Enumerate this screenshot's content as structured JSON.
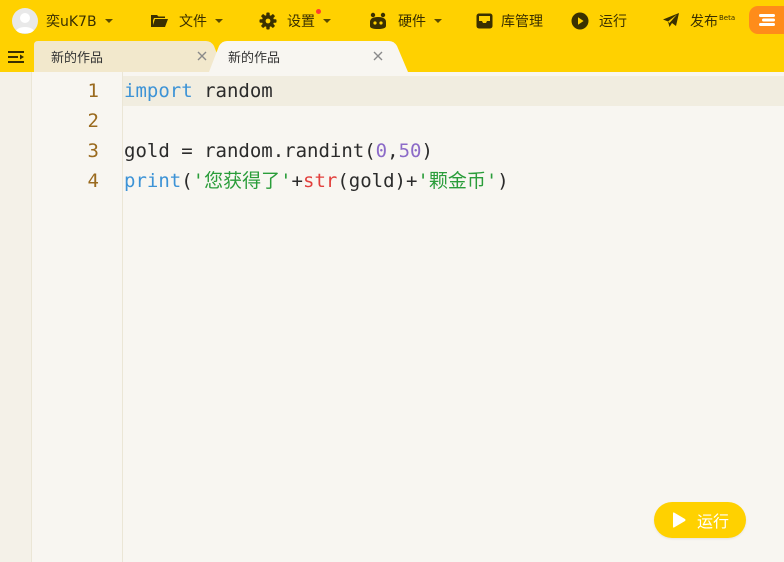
{
  "toolbar": {
    "user": {
      "name": "奕uK7B"
    },
    "file": {
      "label": "文件"
    },
    "settings": {
      "label": "设置"
    },
    "hardware": {
      "label": "硬件"
    },
    "library": {
      "label": "库管理"
    },
    "run": {
      "label": "运行"
    },
    "publish": {
      "label": "发布",
      "badge": "Beta"
    }
  },
  "tabs": [
    {
      "title": "新的作品",
      "active": false
    },
    {
      "title": "新的作品",
      "active": true
    }
  ],
  "editor": {
    "lines": [
      {
        "number": "1",
        "tokens": [
          {
            "t": "import",
            "c": "kw"
          },
          {
            "t": " random",
            "c": ""
          }
        ]
      },
      {
        "number": "2",
        "tokens": []
      },
      {
        "number": "3",
        "tokens": [
          {
            "t": "gold = random.randint(",
            "c": ""
          },
          {
            "t": "0",
            "c": "num"
          },
          {
            "t": ",",
            "c": ""
          },
          {
            "t": "50",
            "c": "num"
          },
          {
            "t": ")",
            "c": ""
          }
        ]
      },
      {
        "number": "4",
        "tokens": [
          {
            "t": "print",
            "c": "kw"
          },
          {
            "t": "(",
            "c": ""
          },
          {
            "t": "'您获得了'",
            "c": "str"
          },
          {
            "t": "+",
            "c": ""
          },
          {
            "t": "str",
            "c": "bi"
          },
          {
            "t": "(gold)+",
            "c": ""
          },
          {
            "t": "'颗金币'",
            "c": "str"
          },
          {
            "t": ")",
            "c": ""
          }
        ]
      }
    ]
  },
  "run_button": {
    "label": "运行"
  },
  "colors": {
    "accent": "#ffd100",
    "keyword": "#3d93d6",
    "number": "#8c6bc8",
    "string": "#2a9d3a",
    "builtin": "#e2403d",
    "line_number": "#9a6a1e"
  }
}
